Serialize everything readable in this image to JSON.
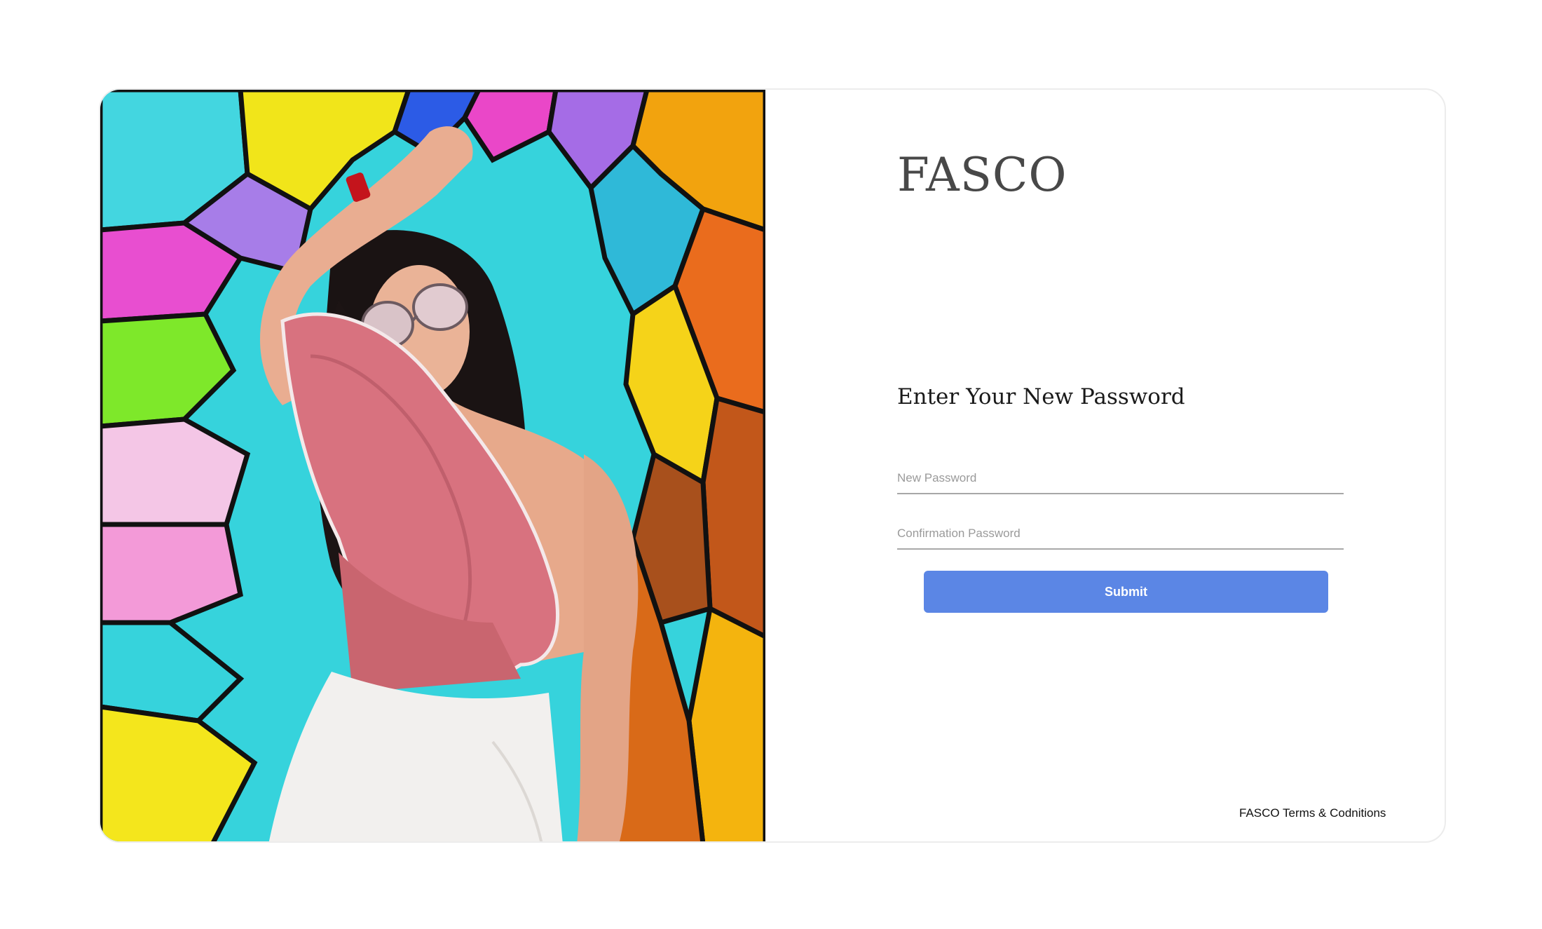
{
  "brand": {
    "logo_text": "FASCO"
  },
  "form": {
    "heading": "Enter Your New Password",
    "new_password_placeholder": "New Password",
    "confirm_password_placeholder": "Confirmation Password",
    "submit_label": "Submit"
  },
  "footer": {
    "terms_link": "FASCO Terms & Codnitions"
  },
  "colors": {
    "accent": "#5b86e5",
    "logo": "#484848",
    "border": "#ececec"
  }
}
